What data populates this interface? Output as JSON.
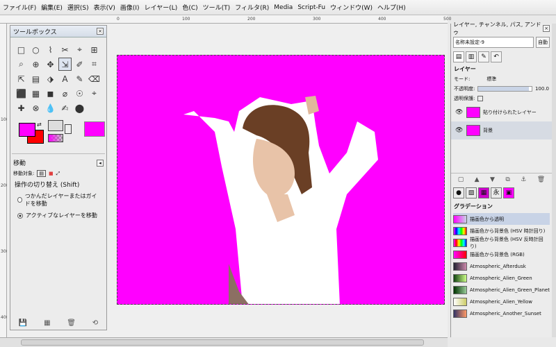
{
  "menubar": [
    "ファイル(F)",
    "編集(E)",
    "選択(S)",
    "表示(V)",
    "画像(I)",
    "レイヤー(L)",
    "色(C)",
    "ツール(T)",
    "フィルタ(R)",
    "Media",
    "Script-Fu",
    "ウィンドウ(W)",
    "ヘルプ(H)"
  ],
  "ruler": {
    "h": [
      "0",
      "100",
      "200",
      "300",
      "400",
      "500"
    ],
    "v": [
      "100",
      "200",
      "300",
      "400"
    ]
  },
  "toolbox": {
    "title": "ツールボックス",
    "tools": [
      "□",
      "○",
      "⌇",
      "✂",
      "⌖",
      "⊞",
      "⌕",
      "⊕",
      "✥",
      "⇲",
      "✐",
      "⌗",
      "⇱",
      "▤",
      "⬗",
      "A",
      "✎",
      "⌫",
      "⬛",
      "▦",
      "◼",
      "⌀",
      "☉",
      "⌖",
      "✚",
      "⊗",
      "💧",
      "✍",
      "⬤"
    ],
    "options_title": "移動",
    "move_target_label": "移動対象:",
    "switch_label": "操作の切り替え (Shift)",
    "radio1": "つかんだレイヤーまたはガイドを移動",
    "radio2": "アクティブなレイヤーを移動"
  },
  "dock": {
    "title": "レイヤー, チャンネル, パス, アンドゥ",
    "image_name": "名称未設定-9",
    "auto_label": "自動",
    "layers_title": "レイヤー",
    "mode_label": "モード:",
    "mode_value": "標準",
    "opacity_label": "不透明度:",
    "opacity_value": "100.0",
    "lock_label": "透明保護:",
    "layers": [
      {
        "name": "貼り付けられたレイヤー",
        "selected": false
      },
      {
        "name": "背景",
        "selected": true
      }
    ],
    "gradient_title": "グラデーション",
    "gradients": [
      {
        "name": "描画色から透明",
        "selected": true
      },
      {
        "name": "描画色から背景色 (HSV 時計回り)",
        "selected": false
      },
      {
        "name": "描画色から背景色 (HSV 反時計回り)",
        "selected": false
      },
      {
        "name": "描画色から背景色 (RGB)",
        "selected": false
      },
      {
        "name": "Atmospheric_Afterdusk",
        "selected": false
      },
      {
        "name": "Atmospheric_Alien_Green",
        "selected": false
      },
      {
        "name": "Atmospheric_Alien_Green_Planet",
        "selected": false
      },
      {
        "name": "Atmospheric_Alien_Yellow",
        "selected": false
      },
      {
        "name": "Atmospheric_Another_Sunset",
        "selected": false
      }
    ]
  },
  "colors": {
    "fg": "#ff00ff",
    "bg": "#ff0000",
    "canvas": "#ff00ff"
  }
}
